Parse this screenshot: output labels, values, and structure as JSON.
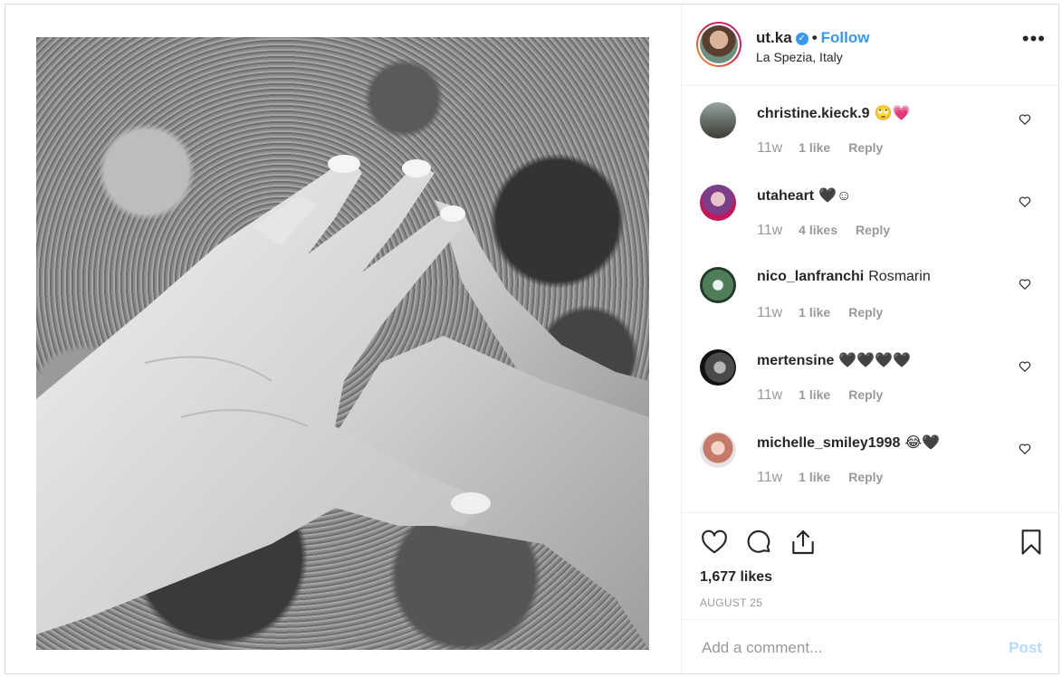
{
  "header": {
    "username": "ut.ka",
    "separator": "•",
    "follow_label": "Follow",
    "location": "La Spezia, Italy",
    "more_label": "•••",
    "verified_mark": "✓"
  },
  "comments": [
    {
      "username": "christine.kieck.9",
      "text": "🙄💗",
      "time": "11w",
      "likes": "1 like",
      "reply": "Reply"
    },
    {
      "username": "utaheart",
      "text": "🖤☺",
      "time": "11w",
      "likes": "4 likes",
      "reply": "Reply"
    },
    {
      "username": "nico_lanfranchi",
      "text": "Rosmarin",
      "time": "11w",
      "likes": "1 like",
      "reply": "Reply"
    },
    {
      "username": "mertensine",
      "text": "🖤🖤🖤🖤",
      "time": "11w",
      "likes": "1 like",
      "reply": "Reply"
    },
    {
      "username": "michelle_smiley1998",
      "text": "😂🖤",
      "time": "11w",
      "likes": "1 like",
      "reply": "Reply"
    }
  ],
  "stats": {
    "likes": "1,677 likes",
    "date": "AUGUST 25"
  },
  "compose": {
    "placeholder": "Add a comment...",
    "post_label": "Post"
  },
  "colors": {
    "accent": "#3897f0",
    "post_disabled": "#b3dbff",
    "muted": "#999999"
  },
  "icons": {
    "like": "heart-icon",
    "comment": "comment-icon",
    "share": "share-icon",
    "save": "bookmark-icon",
    "comment_like": "heart-icon"
  }
}
